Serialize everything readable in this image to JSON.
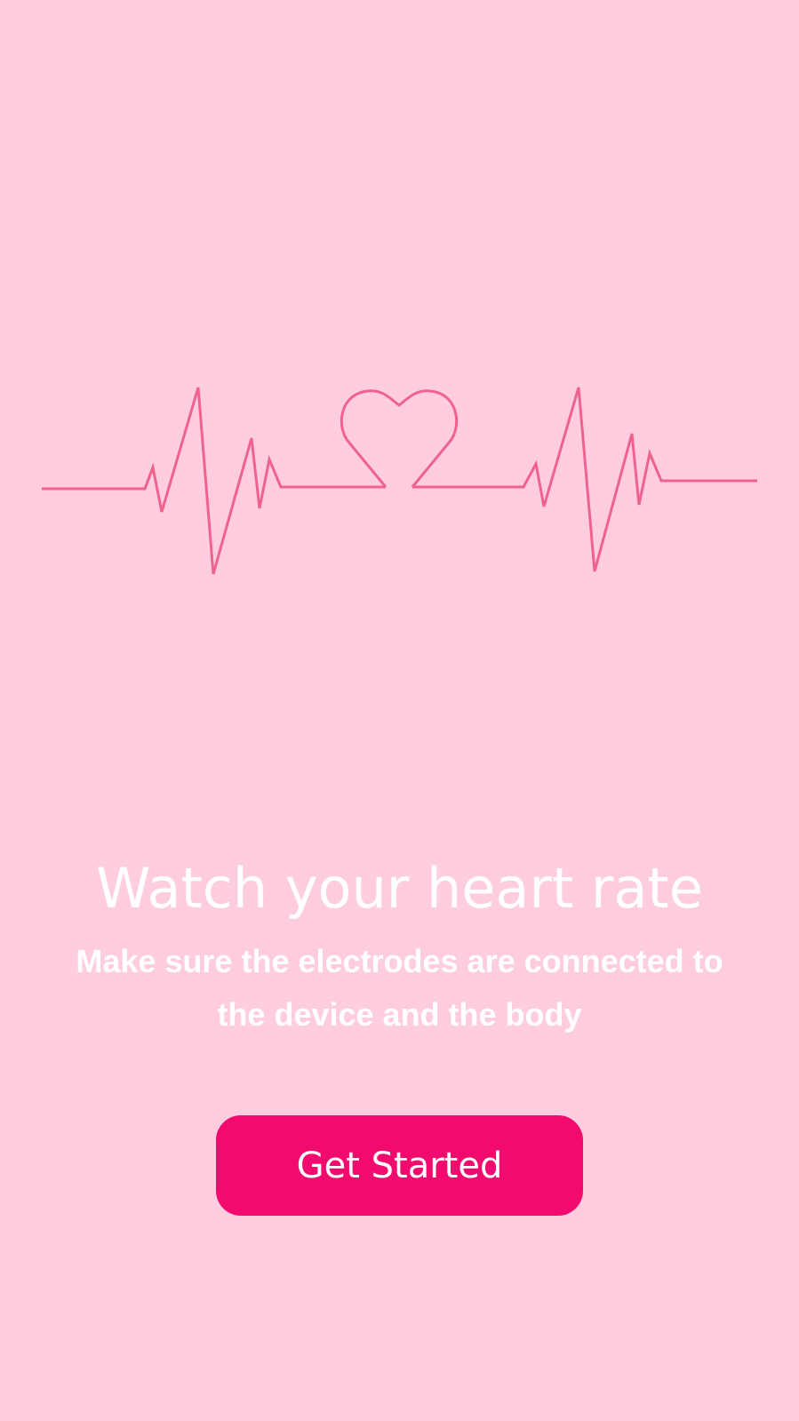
{
  "onboarding": {
    "illustration_icon": "heartbeat-ecg-icon",
    "title": "Watch your heart rate",
    "subtitle": "Make sure the electrodes are connected to the device and the body",
    "cta_label": "Get Started"
  },
  "colors": {
    "background": "#FFCDDF",
    "accent": "#F30A6F",
    "ecg_line": "#F0628E",
    "text": "#FFFFFF"
  }
}
